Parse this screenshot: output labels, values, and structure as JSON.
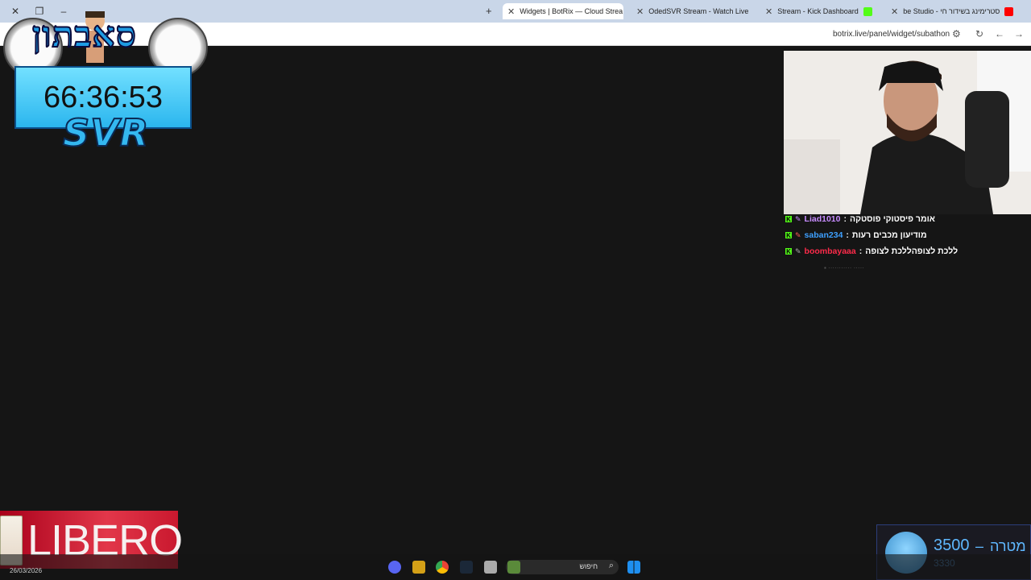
{
  "browser": {
    "tabs": [
      {
        "label": "Widgets | BotRix — Cloud Strea",
        "active": true
      },
      {
        "label": "OdedSVR Stream - Watch Live",
        "active": false
      },
      {
        "label": "Stream - Kick Dashboard",
        "active": false
      },
      {
        "label": "be Studio - סטרימינג בשידור חי",
        "active": false
      }
    ],
    "url": "botrix.live/panel/widget/subathon"
  },
  "timer": {
    "logo_text": "סאבתון",
    "time": "66:36:53",
    "brand": "SVR"
  },
  "chat": [
    {
      "user": "Liad1010",
      "user_color": "#c78cff",
      "message": "אומר פיסטוקי פוסטקה"
    },
    {
      "user": "saban234",
      "user_color": "#3ea0ff",
      "message": "מודיעון מכבים רעות"
    },
    {
      "user": "boombayaaa",
      "user_color": "#ff2b4a",
      "message": "ללכת לצופהללכת לצופה"
    }
  ],
  "sponsor": {
    "brand": "LIBERO"
  },
  "goal": {
    "target": "3500",
    "label": "מטרה",
    "current": "3330"
  },
  "taskbar": {
    "date": "26/03/2026",
    "search_label": "חיפוש"
  }
}
